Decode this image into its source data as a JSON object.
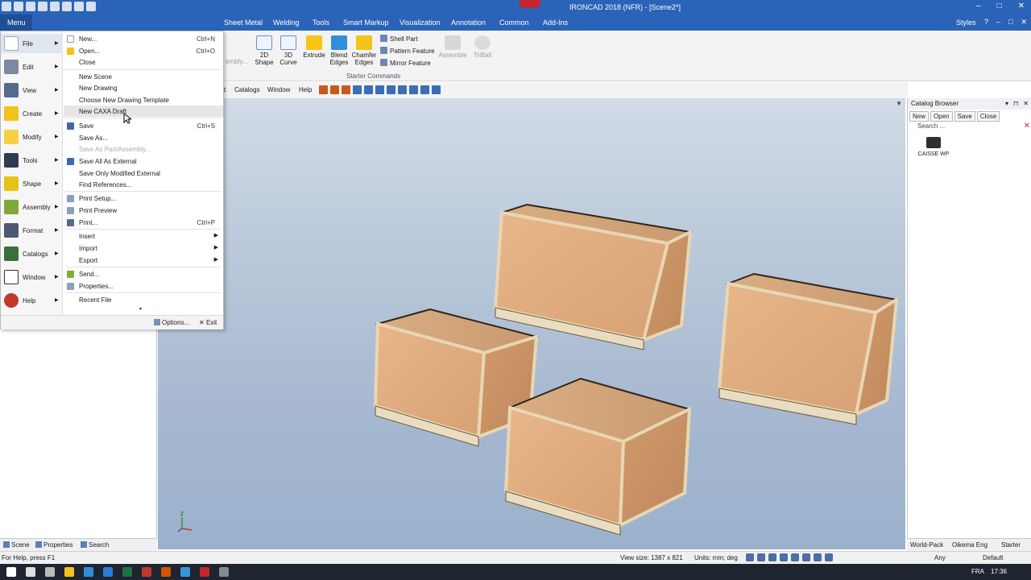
{
  "title_bar": {
    "title": "IRONCAD 2018 (NFR) - [Scene2*]",
    "controls": [
      "–",
      "□",
      "✕"
    ]
  },
  "ribbon": {
    "menu_label": "Menu",
    "tabs": [
      "Sheet Metal",
      "Welding",
      "Tools",
      "Smart Markup",
      "Visualization",
      "Annotation",
      "Common",
      "Add-Ins"
    ],
    "styles_label": "Styles",
    "hidden_label": "embly...",
    "buttons": {
      "shape2d": "2D Shape",
      "curve3d": "3D Curve",
      "extrude": "Extrude",
      "blend": "Blend Edges",
      "chamfer": "Chamfer Edges",
      "shell": "Shell Part",
      "pattern": "Pattern Feature",
      "mirror": "Mirror Feature",
      "assemble": "Assemble",
      "triball": "TriBall"
    },
    "group_label": "Starter Commands"
  },
  "toolbar": {
    "fragment": "t",
    "catalogs": "Catalogs",
    "window": "Window",
    "help": "Help"
  },
  "app_menu": {
    "categories": [
      {
        "label": "File",
        "icon": "file-icon"
      },
      {
        "label": "Edit",
        "icon": "edit-icon"
      },
      {
        "label": "View",
        "icon": "view-icon"
      },
      {
        "label": "Create",
        "icon": "create-icon"
      },
      {
        "label": "Modify",
        "icon": "modify-icon"
      },
      {
        "label": "Tools",
        "icon": "tools-icon"
      },
      {
        "label": "Shape",
        "icon": "shape-icon"
      },
      {
        "label": "Assembly",
        "icon": "assembly-icon"
      },
      {
        "label": "Format",
        "icon": "format-icon"
      },
      {
        "label": "Catalogs",
        "icon": "catalogs-icon"
      },
      {
        "label": "Window",
        "icon": "window-icon"
      },
      {
        "label": "Help",
        "icon": "help-icon"
      }
    ],
    "commands": {
      "new": {
        "label": "New...",
        "shortcut": "Ctrl+N"
      },
      "open": {
        "label": "Open...",
        "shortcut": "Ctrl+O"
      },
      "close": {
        "label": "Close"
      },
      "new_scene": {
        "label": "New Scene"
      },
      "new_drawing": {
        "label": "New Drawing"
      },
      "choose_template": {
        "label": "Choose New Drawing Template"
      },
      "new_caxa": {
        "label": "New CAXA Draft"
      },
      "save": {
        "label": "Save",
        "shortcut": "Ctrl+S"
      },
      "save_as": {
        "label": "Save As..."
      },
      "save_as_part": {
        "label": "Save As Part/Assembly..."
      },
      "save_all_external": {
        "label": "Save All As External"
      },
      "save_modified_external": {
        "label": "Save Only Modified External"
      },
      "find_references": {
        "label": "Find References..."
      },
      "print_setup": {
        "label": "Print Setup..."
      },
      "print_preview": {
        "label": "Print Preview"
      },
      "print": {
        "label": "Print...",
        "shortcut": "Ctrl+P"
      },
      "insert": {
        "label": "Insert"
      },
      "import": {
        "label": "Import"
      },
      "export": {
        "label": "Export"
      },
      "send": {
        "label": "Send..."
      },
      "properties": {
        "label": "Properties..."
      },
      "recent_file": {
        "label": "Recent File"
      }
    },
    "options_label": "Options...",
    "exit_label": "Exit"
  },
  "left_panel": {
    "tabs": [
      "Scene",
      "Properties",
      "Search"
    ]
  },
  "viewport": {
    "axis_label": "Z"
  },
  "catalog_browser": {
    "title": "Catalog Browser",
    "tools": [
      "New",
      "Open",
      "Save",
      "Close"
    ],
    "search_placeholder": "Search ...",
    "item_label": "CAISSE WP",
    "bottom_tabs": [
      "World-Pack",
      "Oikema Eng",
      "Starter"
    ]
  },
  "status_bar": {
    "help_text": "For Help, press F1",
    "view_size": "View size: 1387 x 821",
    "units": "Units: mm; deg",
    "filter": "Any",
    "style": "Default"
  },
  "taskbar": {
    "language": "FRA",
    "time": "17:36"
  }
}
